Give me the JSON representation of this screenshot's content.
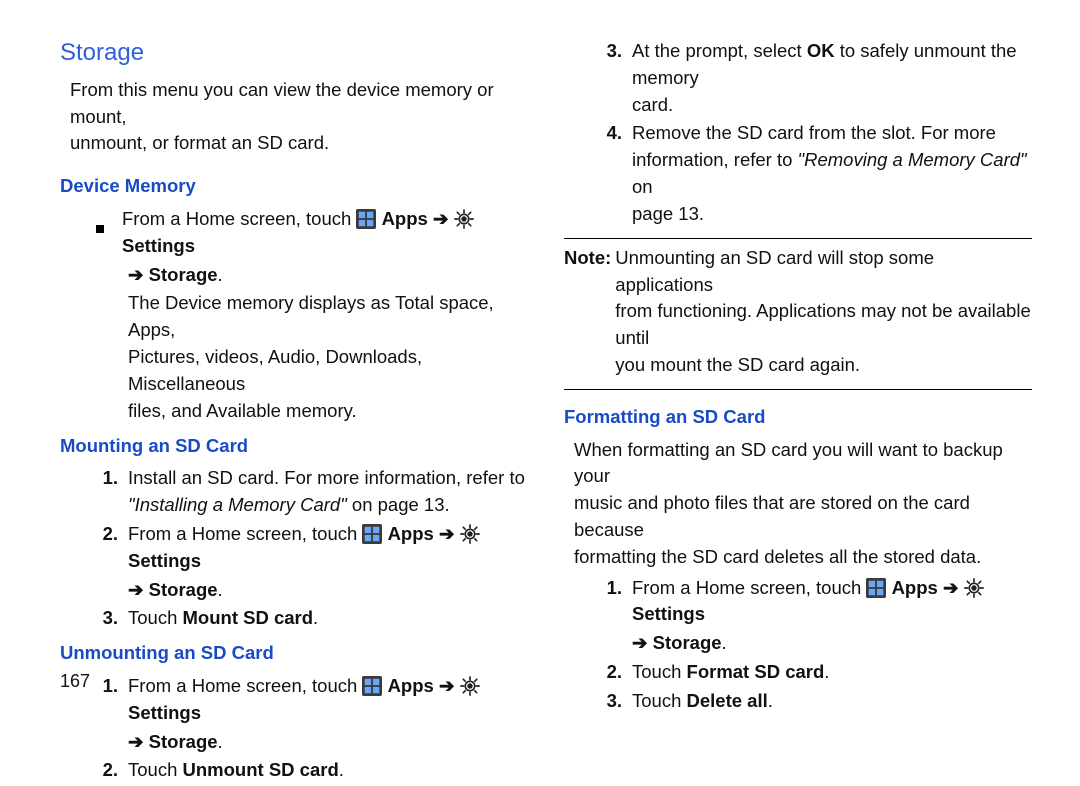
{
  "page_number": "167",
  "title": "Storage",
  "intro_l1": "From this menu you can view the device memory or mount,",
  "intro_l2": "unmount, or format an SD card.",
  "sub_device_memory": "Device Memory",
  "dm_b1_lead": "From a Home screen, touch ",
  "label_apps": " Apps ",
  "label_settings": " Settings",
  "arrow": "➔",
  "arrow_storage": " Storage",
  "period": ".",
  "dm_note_l1": "The Device memory displays as Total space, Apps,",
  "dm_note_l2": "Pictures, videos, Audio, Downloads, Miscellaneous",
  "dm_note_l3": "files, and Available memory.",
  "sub_mount": "Mounting an SD Card",
  "mnt1_l1": "Install an SD card. For more information, refer to",
  "mnt1_ref": "\"Installing a Memory Card\"",
  "mnt1_ref_tail": "  on page 13.",
  "mnt2_lead": "From a Home screen, touch ",
  "mnt3_l1a": "Touch ",
  "mnt3_l1b": "Mount SD card",
  "sub_unmount": "Unmounting an SD Card",
  "umnt1_lead": "From a Home screen, touch ",
  "umnt2_l1a": "Touch ",
  "umnt2_l1b": "Unmount SD card",
  "r_num3": "3.",
  "r3_l1a": "At the prompt, select ",
  "r3_l1b": "OK",
  "r3_l1c": " to safely unmount the memory",
  "r3_l2": "card.",
  "r_num4": "4.",
  "r4_l1": "Remove the SD card from the slot. For more",
  "r4_l2a": "information, refer to ",
  "r4_l2b": "\"Removing a Memory Card\"",
  "r4_l2c": "  on",
  "r4_l3": "page 13.",
  "note_label": "Note:",
  "note_l1": "Unmounting an SD card will stop some applications",
  "note_l2": "from functioning. Applications may not be available until",
  "note_l3": "you mount the SD card again.",
  "sub_format": "Formatting an SD Card",
  "fmt_intro_l1": "When formatting an SD card you will want to backup your",
  "fmt_intro_l2": "music and photo files that are stored on the card because",
  "fmt_intro_l3": "formatting the SD card deletes all the stored data.",
  "fmt1_lead": "From a Home screen, touch ",
  "fmt2_l1a": "Touch ",
  "fmt2_l1b": "Format SD card",
  "fmt3_l1a": "Touch ",
  "fmt3_l1b": "Delete all",
  "n1": "1.",
  "n2": "2.",
  "n3": "3."
}
